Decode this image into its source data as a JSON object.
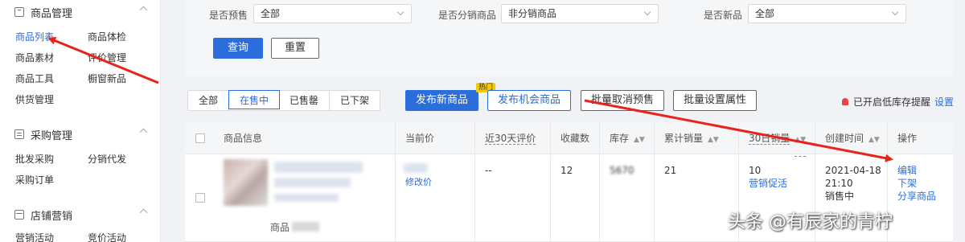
{
  "sidebar": {
    "sections": [
      {
        "title": "商品管理",
        "icon": "box-icon",
        "items": [
          "商品列表",
          "商品体检",
          "商品素材",
          "评价管理",
          "商品工具",
          "橱窗新品",
          "供货管理"
        ]
      },
      {
        "title": "采购管理",
        "icon": "list-icon",
        "items": [
          "批发采购",
          "分销代发",
          "采购订单"
        ]
      },
      {
        "title": "店铺营销",
        "icon": "shop-icon",
        "items": [
          "营销活动",
          "竞价活动"
        ]
      }
    ]
  },
  "filters": {
    "presale": {
      "label": "是否预售",
      "value": "全部"
    },
    "distribution": {
      "label": "是否分销商品",
      "value": "非分销商品"
    },
    "new": {
      "label": "是否新品",
      "value": "全部"
    },
    "query_label": "查询",
    "reset_label": "重置"
  },
  "toolbar": {
    "tabs": [
      "全部",
      "在售中",
      "已售罄",
      "已下架"
    ],
    "active_tab": "在售中",
    "publish_new": "发布新商品",
    "hot_badge": "热门",
    "publish_opportunity": "发布机会商品",
    "batch_cancel_presale": "批量取消预售",
    "batch_set_attr": "批量设置属性",
    "stock_alert": "已开启低库存提醒",
    "settings": "设置"
  },
  "table": {
    "columns": [
      "商品信息",
      "当前价",
      "近30天评价",
      "收藏数",
      "库存",
      "累计销量",
      "30日销量",
      "创建时间",
      "操作"
    ],
    "rows": [
      {
        "product_name_prefix": "商品",
        "price": "修改价",
        "rating": "--",
        "favorites": "12",
        "stock": "5670",
        "total_sales": "21",
        "sales_30d": "10",
        "sales_30d_link": "营销促活",
        "created_date": "2021-04-18",
        "created_time": "21:10",
        "status": "销售中",
        "actions": [
          "编辑",
          "下架",
          "分享商品"
        ]
      }
    ]
  },
  "watermark": "头条 @有辰家的青柠",
  "colors": {
    "primary": "#2a6ddb",
    "annotation_arrow": "#e8231a",
    "hot_badge": "#f7c900"
  }
}
